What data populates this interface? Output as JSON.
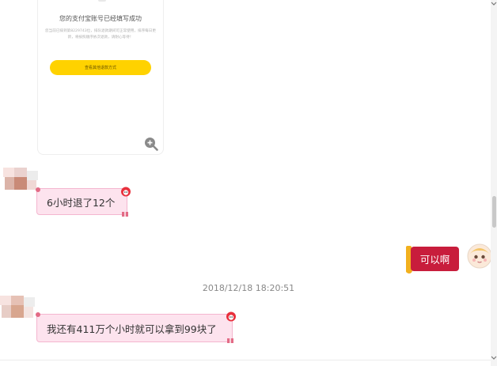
{
  "image_card": {
    "title": "您的支付宝账号已经填写成功",
    "description": "您当前已排到第8229743位，排队退款期间可正常使用，排序每日更新，将按照顺序依次退款，请耐心等待！",
    "button_label": "查看其他退款方式"
  },
  "messages": [
    {
      "side": "left",
      "text": "6小时退了12个"
    },
    {
      "side": "right",
      "text": "可以啊"
    },
    {
      "side": "left",
      "text": "我还有411万个小时就可以拿到99块了"
    }
  ],
  "timestamp": "2018/12/18 18:20:51",
  "colors": {
    "accent_yellow": "#ffd200",
    "pink_bubble": "#fde3ee",
    "pink_border": "#f4b6cf",
    "red_bubble": "#c81d3c",
    "gold": "#f2b01e"
  },
  "icons": {
    "zoom": "zoom-in-icon",
    "scroll_up": "arrow-up-icon",
    "scroll_down": "arrow-down-icon"
  }
}
